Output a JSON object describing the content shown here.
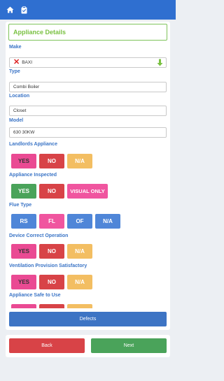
{
  "header": {
    "home_icon": "home-icon",
    "clipboard_icon": "clipboard-check-icon"
  },
  "form": {
    "title": "Appliance Details",
    "make_label": "Make",
    "make_value": "BAXI",
    "type_label": "Type",
    "type_value": "Combi Boiler",
    "location_label": "Location",
    "location_value": "Closet",
    "model_label": "Model",
    "model_value": "630 30KW",
    "landlords_label": "Landlords Appliance",
    "inspected_label": "Appliance Inspected",
    "flue_label": "Flue Type",
    "device_label": "Device Correct Operation",
    "ventilation_label": "Ventilation Provision Satisfactory",
    "safe_label": "Appliance Safe to Use"
  },
  "buttons": {
    "yes": "YES",
    "no": "NO",
    "na": "N/A",
    "visual_only": "VISUAL ONLY",
    "rs": "RS",
    "fl": "FL",
    "of": "OF"
  },
  "actions": {
    "defects": "Defects",
    "back": "Back",
    "next": "Next"
  },
  "colors": {
    "topbar": "#2f6fd0",
    "selected_pink": "#f0559f",
    "selected_green": "#4aa35a",
    "no_red": "#d84347",
    "na_amber": "#f3be62",
    "flue_blue": "#4f86d8"
  }
}
